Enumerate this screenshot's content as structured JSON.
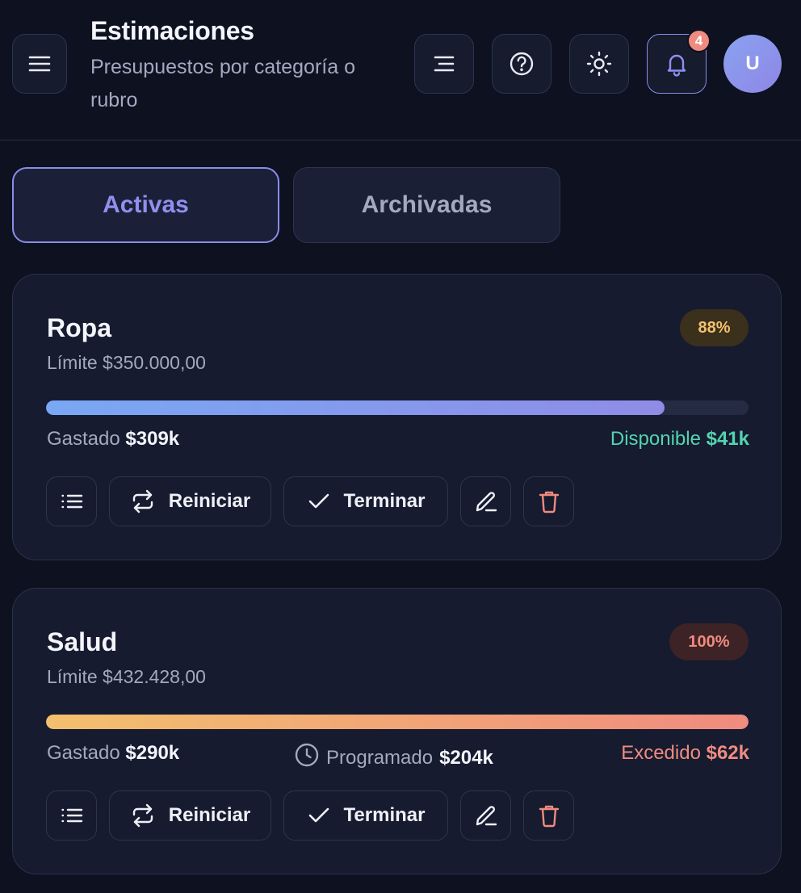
{
  "header": {
    "title": "Estimaciones",
    "subtitle": "Presupuestos por categoría o rubro",
    "notifications_count": "4",
    "avatar_initial": "U",
    "icons": [
      "menu-icon",
      "list-align-icon",
      "help-icon",
      "sun-icon",
      "bell-icon"
    ]
  },
  "tabs": [
    {
      "label": "Activas",
      "active": true
    },
    {
      "label": "Archivadas",
      "active": false
    }
  ],
  "actions": {
    "reset_label": "Reiniciar",
    "finish_label": "Terminar"
  },
  "estimates": [
    {
      "name": "Ropa",
      "limit": "Límite $350.000,00",
      "percent_label": "88%",
      "progress": 0.88,
      "spent_label": "Gastado",
      "spent_value": "$309k",
      "right_label": "Disponible",
      "right_value": "$41k"
    },
    {
      "name": "Salud",
      "limit": "Límite $432.428,00",
      "percent_label": "100%",
      "progress": 1.0,
      "spent_label": "Gastado",
      "spent_value": "$290k",
      "scheduled_label": "Programado",
      "scheduled_value": "$204k",
      "right_label": "Excedido",
      "right_value": "$62k"
    }
  ],
  "colors": {
    "background": "#0d1120",
    "card": "#161b2f",
    "accent": "#8b8ce8",
    "available_green": "#53d4b0",
    "exceeded_red": "#f08b7f",
    "warning_amber": "#f3c06e"
  }
}
